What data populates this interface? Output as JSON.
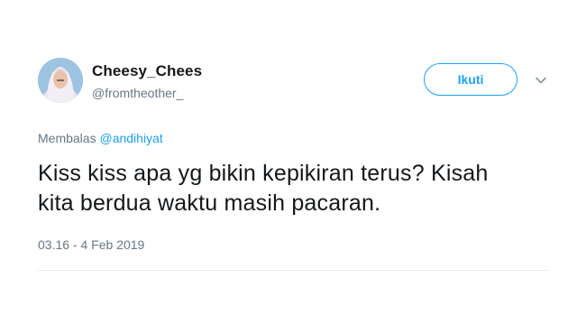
{
  "user": {
    "display_name": "Cheesy_Chees",
    "handle": "@fromtheother_"
  },
  "follow_button": {
    "label": "Ikuti"
  },
  "icons": {
    "more": "chevron-down-icon",
    "avatar": "avatar-image"
  },
  "reply": {
    "prefix": "Membalas",
    "mention": "@andihiyat"
  },
  "tweet": {
    "text_line_1": "Kiss kiss apa yg bikin kepikiran terus? Kisah",
    "text_line_2": "kita berdua waktu masih pacaran.",
    "timestamp": "03.16 - 4 Feb 2019"
  },
  "colors": {
    "accent": "#1da1f2",
    "secondary_text": "#657786",
    "primary_text": "#14171a",
    "divider": "#e6ecf0"
  }
}
